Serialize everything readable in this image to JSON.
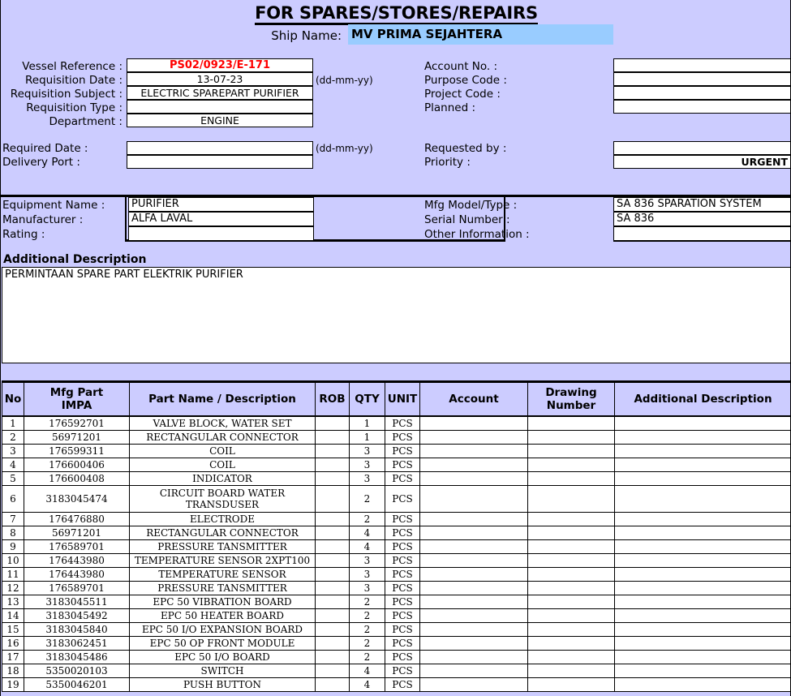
{
  "document": {
    "title": "FOR SPARES/STORES/REPAIRS"
  },
  "ship": {
    "label": "Ship Name:",
    "value": "MV PRIMA SEJAHTERA"
  },
  "left_form": {
    "vessel_reference": {
      "label": "Vessel Reference :",
      "value": "PS02/0923/E-171"
    },
    "requisition_date": {
      "label": "Requisition Date :",
      "value": "13-07-23",
      "hint": "(dd-mm-yy)"
    },
    "requisition_subject": {
      "label": "Requisition Subject :",
      "value": "ELECTRIC SPAREPART  PURIFIER"
    },
    "requisition_type": {
      "label": "Requisition Type   :",
      "value": ""
    },
    "department": {
      "label": "Department   :",
      "value": "ENGINE"
    },
    "required_date": {
      "label": "Required Date :",
      "value": "",
      "hint": "(dd-mm-yy)"
    },
    "delivery_port": {
      "label": "Delivery Port :",
      "value": ""
    }
  },
  "right_form": {
    "account_no": {
      "label": "Account No.  :",
      "value": ""
    },
    "purpose_code": {
      "label": "Purpose Code  :",
      "value": ""
    },
    "project_code": {
      "label": "Project Code  :",
      "value": ""
    },
    "planned": {
      "label": "Planned :",
      "value": ""
    },
    "requested_by": {
      "label": "Requested by :",
      "value": ""
    },
    "priority": {
      "label": "Priority :",
      "value": "URGENT"
    }
  },
  "equipment": {
    "equipment_name": {
      "label": "Equipment Name :",
      "value": "PURIFIER"
    },
    "manufacturer": {
      "label": "Manufacturer :",
      "value": "ALFA LAVAL"
    },
    "rating": {
      "label": "Rating :",
      "value": ""
    },
    "mfg_model_type": {
      "label": "Mfg Model/Type :",
      "value": "SA 836 SPARATION SYSTEM"
    },
    "serial_number": {
      "label": "Serial Number :",
      "value": "SA 836"
    },
    "other_information": {
      "label": "Other Information :",
      "value": ""
    }
  },
  "additional_description": {
    "title": "Additional Description",
    "text": "PERMINTAAN SPARE PART  ELEKTRIK PURIFIER"
  },
  "parts_table": {
    "columns": [
      {
        "key": "no",
        "label": "No"
      },
      {
        "key": "mfg",
        "label": "Mfg Part",
        "label2": "IMPA"
      },
      {
        "key": "name",
        "label": "Part Name / Description"
      },
      {
        "key": "rob",
        "label": "ROB"
      },
      {
        "key": "qty",
        "label": "QTY"
      },
      {
        "key": "unit",
        "label": "UNIT"
      },
      {
        "key": "account",
        "label": "Account"
      },
      {
        "key": "drawing",
        "label": "Drawing",
        "label2": "Number"
      },
      {
        "key": "additional",
        "label": "Additional Description"
      }
    ],
    "rows": [
      {
        "no": "1",
        "mfg": "176592701",
        "name": "VALVE BLOCK, WATER SET",
        "rob": "",
        "qty": "1",
        "unit": "PCS",
        "account": "",
        "drawing": "",
        "additional": ""
      },
      {
        "no": "2",
        "mfg": "56971201",
        "name": "RECTANGULAR CONNECTOR",
        "rob": "",
        "qty": "1",
        "unit": "PCS",
        "account": "",
        "drawing": "",
        "additional": ""
      },
      {
        "no": "3",
        "mfg": "176599311",
        "name": "COIL",
        "rob": "",
        "qty": "3",
        "unit": "PCS",
        "account": "",
        "drawing": "",
        "additional": ""
      },
      {
        "no": "4",
        "mfg": "176600406",
        "name": "COIL",
        "rob": "",
        "qty": "3",
        "unit": "PCS",
        "account": "",
        "drawing": "",
        "additional": ""
      },
      {
        "no": "5",
        "mfg": "176600408",
        "name": "INDICATOR",
        "rob": "",
        "qty": "3",
        "unit": "PCS",
        "account": "",
        "drawing": "",
        "additional": ""
      },
      {
        "no": "6",
        "mfg": "3183045474",
        "name": "CIRCUIT BOARD WATER TRANSDUSER",
        "rob": "",
        "qty": "2",
        "unit": "PCS",
        "account": "",
        "drawing": "",
        "additional": "",
        "tall": true
      },
      {
        "no": "7",
        "mfg": "176476880",
        "name": "ELECTRODE",
        "rob": "",
        "qty": "2",
        "unit": "PCS",
        "account": "",
        "drawing": "",
        "additional": ""
      },
      {
        "no": "8",
        "mfg": "56971201",
        "name": "RECTANGULAR CONNECTOR",
        "rob": "",
        "qty": "4",
        "unit": "PCS",
        "account": "",
        "drawing": "",
        "additional": ""
      },
      {
        "no": "9",
        "mfg": "176589701",
        "name": "PRESSURE TANSMITTER",
        "rob": "",
        "qty": "4",
        "unit": "PCS",
        "account": "",
        "drawing": "",
        "additional": ""
      },
      {
        "no": "10",
        "mfg": "176443980",
        "name": "TEMPERATURE SENSOR 2XPT100",
        "rob": "",
        "qty": "3",
        "unit": "PCS",
        "account": "",
        "drawing": "",
        "additional": ""
      },
      {
        "no": "11",
        "mfg": "176443980",
        "name": "TEMPERATURE SENSOR",
        "rob": "",
        "qty": "3",
        "unit": "PCS",
        "account": "",
        "drawing": "",
        "additional": ""
      },
      {
        "no": "12",
        "mfg": "176589701",
        "name": "PRESSURE TANSMITTER",
        "rob": "",
        "qty": "3",
        "unit": "PCS",
        "account": "",
        "drawing": "",
        "additional": ""
      },
      {
        "no": "13",
        "mfg": "3183045511",
        "name": "EPC 50 VIBRATION BOARD",
        "rob": "",
        "qty": "2",
        "unit": "PCS",
        "account": "",
        "drawing": "",
        "additional": ""
      },
      {
        "no": "14",
        "mfg": "3183045492",
        "name": "EPC 50 HEATER BOARD",
        "rob": "",
        "qty": "2",
        "unit": "PCS",
        "account": "",
        "drawing": "",
        "additional": ""
      },
      {
        "no": "15",
        "mfg": "3183045840",
        "name": "EPC 50 I/O EXPANSION BOARD",
        "rob": "",
        "qty": "2",
        "unit": "PCS",
        "account": "",
        "drawing": "",
        "additional": ""
      },
      {
        "no": "16",
        "mfg": "3183062451",
        "name": "EPC 50 OP FRONT MODULE",
        "rob": "",
        "qty": "2",
        "unit": "PCS",
        "account": "",
        "drawing": "",
        "additional": ""
      },
      {
        "no": "17",
        "mfg": "3183045486",
        "name": "EPC 50 I/O BOARD",
        "rob": "",
        "qty": "2",
        "unit": "PCS",
        "account": "",
        "drawing": "",
        "additional": ""
      },
      {
        "no": "18",
        "mfg": "5350020103",
        "name": "SWITCH",
        "rob": "",
        "qty": "4",
        "unit": "PCS",
        "account": "",
        "drawing": "",
        "additional": ""
      },
      {
        "no": "19",
        "mfg": "5350046201",
        "name": "PUSH BUTTON",
        "rob": "",
        "qty": "4",
        "unit": "PCS",
        "account": "",
        "drawing": "",
        "additional": ""
      }
    ]
  },
  "colors": {
    "page_background": "#CCCCFF",
    "ship_field_background": "#99CCFF",
    "vessel_reference_text": "#FF0000",
    "field_background": "#FFFFFF",
    "border": "#000000"
  }
}
